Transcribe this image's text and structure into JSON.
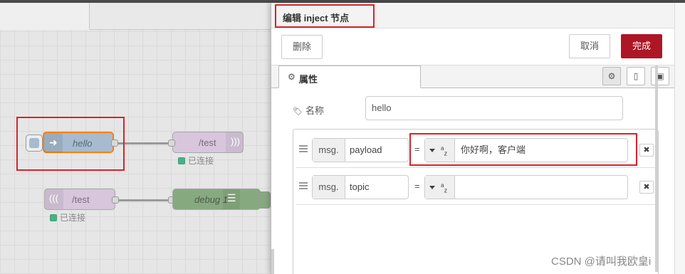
{
  "flow": {
    "nodes": [
      {
        "label": "hello"
      },
      {
        "label": "/test",
        "status": "已连接"
      },
      {
        "label": "/test",
        "status": "已连接"
      },
      {
        "label": "debug 1"
      }
    ]
  },
  "editor": {
    "title": "编辑 inject 节点",
    "buttons": {
      "delete": "删除",
      "cancel": "取消",
      "done": "完成"
    },
    "tab": {
      "label": "属性"
    },
    "name": {
      "label": "名称",
      "value": "hello"
    },
    "rules": [
      {
        "prefix": "msg.",
        "property": "payload",
        "eq": "=",
        "type_icon": "az",
        "value": "你好啊，客户端"
      },
      {
        "prefix": "msg.",
        "property": "topic",
        "eq": "=",
        "type_icon": "az",
        "value": ""
      }
    ],
    "delete_glyph": "✖"
  },
  "watermark": "CSDN @请叫我欧皇i",
  "colors": {
    "primary_button": "#ad1625",
    "highlight": "#d9222a",
    "inject_node": "#a6bbcf",
    "websocket_node": "#d7c6dc",
    "debug_node": "#87a980"
  }
}
